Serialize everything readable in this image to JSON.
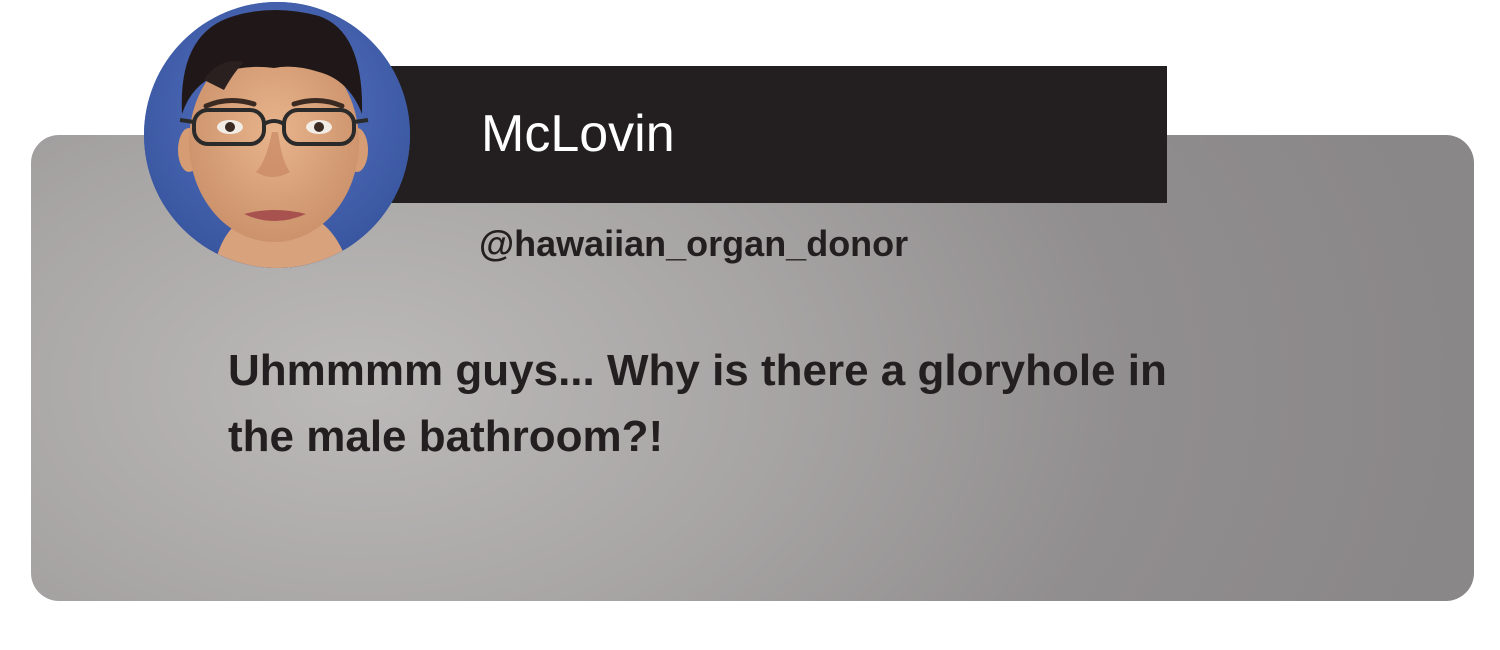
{
  "post": {
    "display_name": "McLovin",
    "handle": "@hawaiian_organ_donor",
    "message": "Uhmmmm guys... Why is there a gloryhole in the male bathroom?!",
    "avatar_icon": "profile-photo-icon"
  },
  "colors": {
    "name_bar": "#231f20",
    "name_text": "#ffffff",
    "body_text": "#231f20",
    "card": "#a7a4a4",
    "avatar_background": "#3e5ca3"
  }
}
